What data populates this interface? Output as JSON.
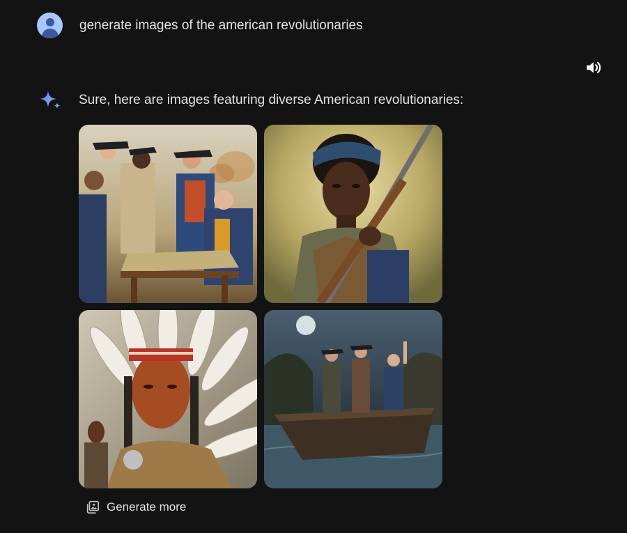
{
  "user_message": {
    "avatar": "user-avatar-icon",
    "text": "generate images of the american revolutionaries"
  },
  "assistant_message": {
    "icon": "sparkle-icon",
    "text": "Sure, here are images featuring diverse American revolutionaries:",
    "speaker_icon": "speaker-icon",
    "images": [
      {
        "subject": "colonial officers around a map table"
      },
      {
        "subject": "woman holding a musket"
      },
      {
        "subject": "native leader in feather headdress"
      },
      {
        "subject": "figures standing in a rowboat at night"
      }
    ]
  },
  "actions": {
    "generate_more_label": "Generate more",
    "generate_more_icon": "image-stack-icon"
  },
  "colors": {
    "background": "#131314",
    "text": "#e3e3e3",
    "avatar": "#a8c7fa",
    "sparkle": "#5b8def"
  }
}
